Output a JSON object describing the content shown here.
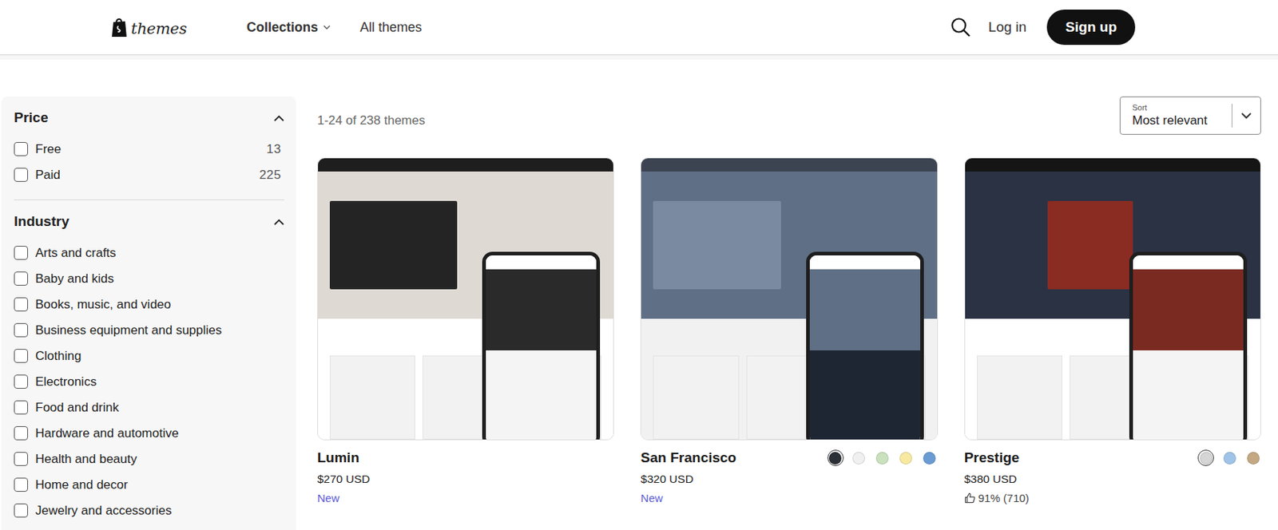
{
  "header": {
    "logo": "themes",
    "nav": [
      {
        "label": "Collections",
        "has_menu": true
      },
      {
        "label": "All themes",
        "has_menu": false
      }
    ],
    "login": "Log in",
    "signup": "Sign up"
  },
  "filters": [
    {
      "title": "Price",
      "expanded": true,
      "options": [
        {
          "label": "Free",
          "count": "13",
          "checked": false
        },
        {
          "label": "Paid",
          "count": "225",
          "checked": false
        }
      ]
    },
    {
      "title": "Industry",
      "expanded": true,
      "options": [
        {
          "label": "Arts and crafts",
          "count": "",
          "checked": false
        },
        {
          "label": "Baby and kids",
          "count": "",
          "checked": false
        },
        {
          "label": "Books, music, and video",
          "count": "",
          "checked": false
        },
        {
          "label": "Business equipment and supplies",
          "count": "",
          "checked": false
        },
        {
          "label": "Clothing",
          "count": "",
          "checked": false
        },
        {
          "label": "Electronics",
          "count": "",
          "checked": false
        },
        {
          "label": "Food and drink",
          "count": "",
          "checked": false
        },
        {
          "label": "Hardware and automotive",
          "count": "",
          "checked": false
        },
        {
          "label": "Health and beauty",
          "count": "",
          "checked": false
        },
        {
          "label": "Home and decor",
          "count": "",
          "checked": false
        },
        {
          "label": "Jewelry and accessories",
          "count": "",
          "checked": false
        }
      ]
    }
  ],
  "results": {
    "summary": "1-24 of 238 themes",
    "sort": {
      "label": "Sort",
      "value": "Most relevant"
    }
  },
  "themes": [
    {
      "name": "Lumin",
      "price": "$270 USD",
      "badge": "New",
      "rating": "",
      "swatches": []
    },
    {
      "name": "San Francisco",
      "price": "$320 USD",
      "badge": "New",
      "rating": "",
      "swatches": [
        {
          "color": "#2b2f36",
          "selected": true
        },
        {
          "color": "#f0f0f0",
          "selected": false
        },
        {
          "color": "#c9e1bd",
          "selected": false
        },
        {
          "color": "#f8e9a1",
          "selected": false
        },
        {
          "color": "#6a9bd3",
          "selected": false
        }
      ]
    },
    {
      "name": "Prestige",
      "price": "$380 USD",
      "badge": "",
      "rating": "91% (710)",
      "swatches": [
        {
          "color": "#d6d6d6",
          "selected": true
        },
        {
          "color": "#a0c4e8",
          "selected": false
        },
        {
          "color": "#c4a883",
          "selected": false
        }
      ]
    }
  ]
}
